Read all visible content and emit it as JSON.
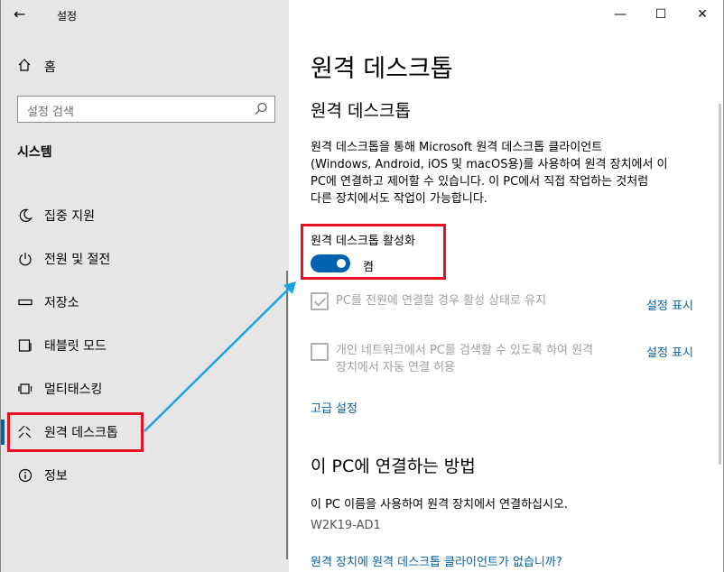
{
  "window": {
    "title": "설정",
    "back_icon": "←",
    "minimize_icon": "—",
    "maximize_icon": "☐",
    "close_icon": "✕"
  },
  "sidebar": {
    "home_label": "홈",
    "search_placeholder": "설정 검색",
    "section_title": "시스템",
    "items": [
      {
        "label": "집중 지원",
        "icon": "moon-icon"
      },
      {
        "label": "전원 및 절전",
        "icon": "power-icon"
      },
      {
        "label": "저장소",
        "icon": "storage-icon"
      },
      {
        "label": "태블릿 모드",
        "icon": "tablet-icon"
      },
      {
        "label": "멀티태스킹",
        "icon": "multitasking-icon"
      },
      {
        "label": "원격 데스크톱",
        "icon": "remote-desktop-icon",
        "active": true
      },
      {
        "label": "정보",
        "icon": "info-icon"
      }
    ]
  },
  "main": {
    "page_heading": "원격 데스크톱",
    "sub_heading": "원격 데스크톱",
    "description": "원격 데스크톱을 통해 Microsoft 원격 데스크톱 클라이언트 (Windows, Android, iOS 및 macOS용)를 사용하여 원격 장치에서 이 PC에 연결하고 제어할 수 있습니다. 이 PC에서 직접 작업하는 것처럼 다른 장치에서도 작업이 가능합니다.",
    "description_lines": [
      "원격 데스크톱을 통해 Microsoft 원격 데스크톱 클라이언트",
      "(Windows, Android, iOS 및 macOS용)를 사용하여 원격 장치에서 이",
      "PC에 연결하고 제어할 수 있습니다. 이 PC에서 직접 작업하는 것처럼",
      "다른 장치에서도 작업이 가능합니다."
    ],
    "enable_label": "원격 데스크톱 활성화",
    "toggle_state": "켬",
    "toggle_on": true,
    "option1": {
      "label": "PC를 전원에 연결할 경우 활성 상태로 유지",
      "checked": true,
      "link": "설정 표시"
    },
    "option2": {
      "label_lines": [
        "개인 네트워크에서 PC를 검색할 수 있도록 하여 원격",
        "장치에서 자동 연결 허용"
      ],
      "checked": false,
      "link": "설정 표시"
    },
    "advanced_link": "고급 설정",
    "how_heading": "이 PC에 연결하는 방법",
    "how_desc": "이 PC 이름을 사용하여 원격 장치에서 연결하십시오.",
    "pc_name": "W2K19-AD1",
    "no_client_link": "원격 장치에 원격 데스크톱 클라이언트가 없습니까?"
  },
  "colors": {
    "accent": "#0063b1",
    "highlight": "#e81123",
    "arrow": "#1ba1e2",
    "sidebar_bg": "#e6e6e6"
  }
}
